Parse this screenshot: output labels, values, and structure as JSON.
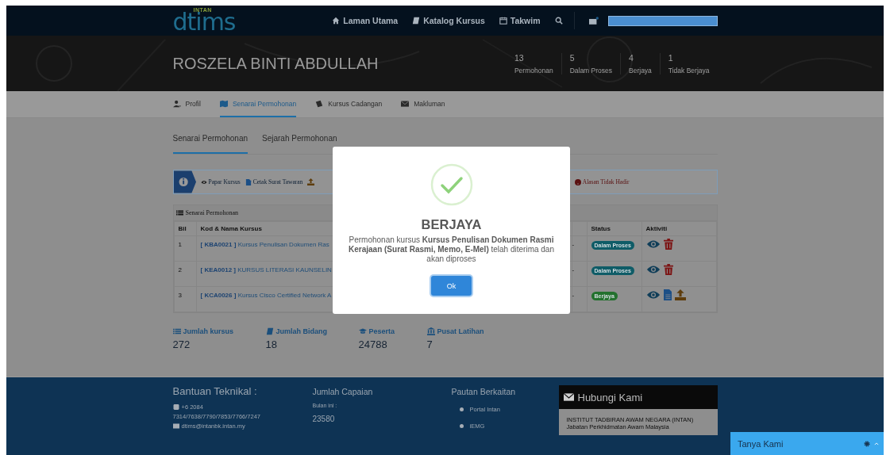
{
  "nav": {
    "logo_tag": "INTAN",
    "logo": "dtims",
    "links": [
      {
        "label": "Laman Utama"
      },
      {
        "label": "Katalog Kursus"
      },
      {
        "label": "Takwim"
      }
    ]
  },
  "profile": {
    "name": "ROSZELA BINTI ABDULLAH",
    "stats": [
      {
        "value": "13",
        "label": "Permohonan"
      },
      {
        "value": "5",
        "label": "Dalam Proses"
      },
      {
        "value": "4",
        "label": "Berjaya"
      },
      {
        "value": "1",
        "label": "Tidak Berjaya"
      }
    ]
  },
  "tabs": [
    {
      "label": "Profil",
      "selected": false
    },
    {
      "label": "Senarai Permohonan",
      "selected": true
    },
    {
      "label": "Kursus Cadangan",
      "selected": false
    },
    {
      "label": "Makluman",
      "selected": false
    }
  ],
  "subtabs": [
    {
      "label": "Senarai Permohonan",
      "selected": true
    },
    {
      "label": "Sejarah Permohonan",
      "selected": false
    }
  ],
  "toolbar": [
    {
      "kind": "view",
      "label": "Papar Kursus"
    },
    {
      "kind": "print",
      "label": "Cetak Surat Tawaran"
    },
    {
      "kind": "reason",
      "label": "Alasan Tidak Hadir"
    }
  ],
  "table": {
    "title": "Senarai Permohonan",
    "columns": [
      "Bil",
      "Kod & Nama Kursus",
      "Status",
      "Aktiviti"
    ],
    "rows": [
      {
        "bil": "1",
        "code": "[ KBA0021 ]",
        "name": "Kursus Penulisan Dokumen Ras",
        "column_3": "-",
        "status": {
          "label": "Dalam Proses",
          "kind": "process"
        }
      },
      {
        "bil": "2",
        "code": "[ KEA0012 ]",
        "name": "KURSUS LITERASI KAUNSELIN",
        "column_3": "-",
        "status": {
          "label": "Dalam Proses",
          "kind": "process"
        }
      },
      {
        "bil": "3",
        "code": "[ KCA0026 ]",
        "name": "Kursus Cisco Certified Network A",
        "column_3": "-",
        "status": {
          "label": "Berjaya",
          "kind": "success"
        }
      }
    ]
  },
  "summary": [
    {
      "label": "Jumlah kursus",
      "value": "272"
    },
    {
      "label": "Jumlah Bidang",
      "value": "18"
    },
    {
      "label": "Peserta",
      "value": "24788"
    },
    {
      "label": "Pusat Latihan",
      "value": "7"
    }
  ],
  "footer": {
    "help_title": "Bantuan Teknikal :",
    "phone": "+6 2084",
    "phone_more": "7314/7638/7790/7853/7766/7247",
    "email": "dtims@intanbk.intan.my",
    "visits_title": "Jumlah Capaian",
    "visits_label": "Bulan ini :",
    "visits_value": "23580",
    "links_title": "Pautan Berkaitan",
    "links": [
      "Portal Intan",
      "iEMG"
    ],
    "contact_title": "Hubungi Kami",
    "contact_lines": [
      "INSTITUT TADBIRAN AWAM NEGARA (INTAN)",
      "Jabatan Perkhidmatan Awam Malaysia"
    ]
  },
  "modal": {
    "title": "BERJAYA",
    "message": "Permohonan kursus **Kursus Penulisan Dokumen Rasmi Kerajaan (Surat Rasmi, Memo, E-Mel)** telah diterima dan akan diproses",
    "button": "Ok"
  },
  "chat": {
    "label": "Tanya Kami"
  }
}
